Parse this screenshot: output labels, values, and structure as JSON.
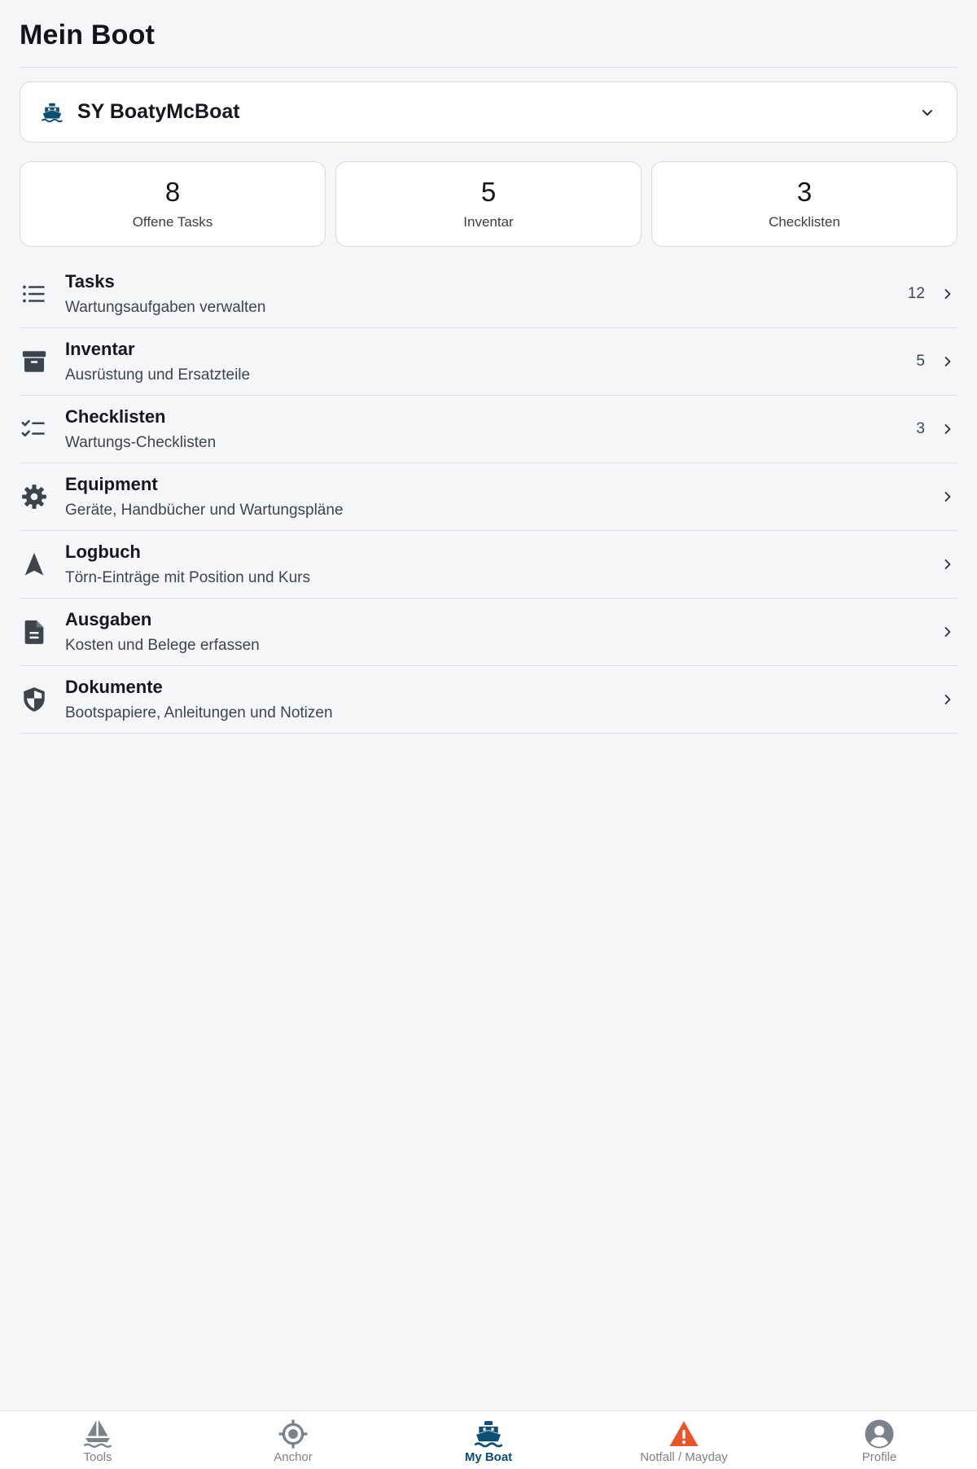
{
  "page": {
    "title": "Mein Boot"
  },
  "boat_selector": {
    "value": "SY BoatyMcBoat",
    "icon": "boat-icon"
  },
  "stats": [
    {
      "value": "8",
      "label": "Offene Tasks"
    },
    {
      "value": "5",
      "label": "Inventar"
    },
    {
      "value": "3",
      "label": "Checklisten"
    }
  ],
  "menu": [
    {
      "title": "Tasks",
      "subtitle": "Wartungsaufgaben verwalten",
      "count": "12",
      "icon": "list-icon"
    },
    {
      "title": "Inventar",
      "subtitle": "Ausrüstung und Ersatzteile",
      "count": "5",
      "icon": "archive-box-icon"
    },
    {
      "title": "Checklisten",
      "subtitle": "Wartungs-Checklisten",
      "count": "3",
      "icon": "checklist-icon"
    },
    {
      "title": "Equipment",
      "subtitle": "Geräte, Handbücher und Wartungspläne",
      "count": "",
      "icon": "gear-icon"
    },
    {
      "title": "Logbuch",
      "subtitle": "Törn-Einträge mit Position und Kurs",
      "count": "",
      "icon": "navigation-arrow-icon"
    },
    {
      "title": "Ausgaben",
      "subtitle": "Kosten und Belege erfassen",
      "count": "",
      "icon": "document-icon"
    },
    {
      "title": "Dokumente",
      "subtitle": "Bootspapiere, Anleitungen und Notizen",
      "count": "",
      "icon": "shield-icon"
    }
  ],
  "tabs": [
    {
      "label": "Tools",
      "icon": "sailboat-icon",
      "active": false
    },
    {
      "label": "Anchor",
      "icon": "crosshair-icon",
      "active": false
    },
    {
      "label": "My Boat",
      "icon": "boat-icon",
      "active": true
    },
    {
      "label": "Notfall / Mayday",
      "icon": "warning-icon",
      "active": false
    },
    {
      "label": "Profile",
      "icon": "profile-icon",
      "active": false
    }
  ],
  "colors": {
    "accent": "#0f4e73",
    "warning": "#e4572e",
    "icon": "#3d444b",
    "background": "#f4f6f8"
  }
}
